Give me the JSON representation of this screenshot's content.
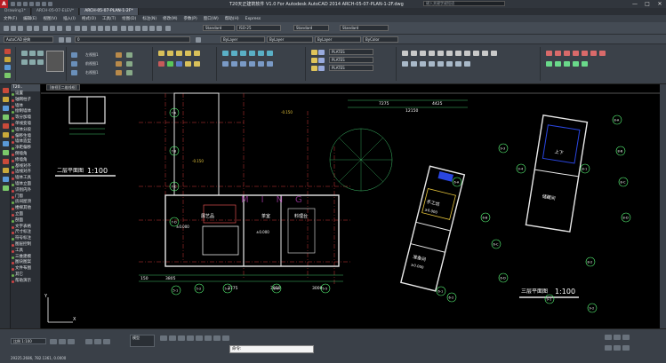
{
  "app": {
    "title": "T20天正建筑软件 V1.0 For Autodesk AutoCAD 2014    ARCH-05-07-PLAN-1-2F.dwg",
    "logo": "A",
    "search_placeholder": "键入关键字或短语",
    "window_controls": [
      "—",
      "□",
      "✕"
    ]
  },
  "tabs": [
    "Drawing1*",
    "ARCH-05-07-ELEV*",
    "ARCH-05-07-PLAN-1-2F*"
  ],
  "menu": [
    "文件(F)",
    "编辑(E)",
    "视图(V)",
    "插入(I)",
    "格式(O)",
    "工具(T)",
    "绘图(D)",
    "标注(N)",
    "修改(M)",
    "参数(P)",
    "窗口(W)",
    "帮助(H)",
    "Express"
  ],
  "toolbar": {
    "workspace": "AutoCAD 经典",
    "textstyle": "Standard",
    "dimstyle": "ISO-25",
    "tablestyle": "Standard",
    "mleaderstyle": "Standard",
    "color": "ByLayer",
    "linetype": "ByLayer",
    "lineweight": "ByLayer",
    "plotstyle": "ByColor"
  },
  "ribbon": {
    "layers": [
      "0",
      "PLATES",
      "PLATES",
      "PLATES"
    ],
    "labels": [
      "左视图1",
      "前视图1",
      "右视图1"
    ]
  },
  "tangent_panel": {
    "header": "T20..",
    "items": [
      "设置",
      "轴网柱子",
      "墙体",
      "绘制墙体",
      "等分加墙",
      "单线变墙",
      "墙体分段",
      "偏移生墙",
      "墙体造型",
      "净距偏移",
      "倒墙角",
      "修墙角",
      "基线对齐",
      "边线对齐",
      "墙体工具",
      "墙体立面",
      "识别内外",
      "门窗",
      "房间屋顶",
      "楼梯其他",
      "立面",
      "剖面",
      "文字表格",
      "尺寸标注",
      "符号标注",
      "图层控制",
      "工具",
      "三维建模",
      "图块图案",
      "文件布图",
      "其它",
      "帮助演示"
    ]
  },
  "viewport_tabs": [
    "[俯视][二维线框]"
  ],
  "drawing": {
    "plan_title_left": "二层平面图",
    "plan_scale_left": "1:100",
    "plan_title_right": "三层平面图",
    "plan_scale_right": "1:100",
    "room_labels": [
      "展艺品",
      "茶室",
      "料理台",
      "手工坊",
      "准备间",
      "储藏间",
      "上下"
    ],
    "elevations": [
      "±0.000",
      "±0.000",
      "±0.000",
      "±0.000",
      "-0.150",
      "±0.000",
      "-0.150"
    ],
    "dims_top": [
      "7275",
      "4425",
      "12150",
      "4325",
      "4875"
    ],
    "dims_bottom": [
      "150",
      "3805",
      "3775",
      "3000",
      "3000",
      "1450",
      "900",
      "1700",
      "1700",
      "1000",
      "2700",
      "1000",
      "450"
    ],
    "dims_small": [
      "2000",
      "3600",
      "3700",
      "200",
      "2600",
      "2000",
      "3400",
      "1800",
      "2000",
      "1200",
      "400",
      "1900",
      "3400",
      "2400",
      "3400",
      "6000",
      "3000",
      "2000",
      "5700",
      "1300",
      "1150",
      "1800",
      "2050",
      "2550",
      "2400",
      "900"
    ],
    "axis_bubbles": [
      "7-A",
      "7-B",
      "7-C",
      "7-D",
      "5-5",
      "5-4",
      "5-3",
      "5-2",
      "5-1",
      "6-1",
      "6-2",
      "6-A",
      "6-B",
      "6-C",
      "6-D",
      "8-A",
      "8-B",
      "8-C",
      "8-D",
      "8-1",
      "8-2",
      "9-1",
      "9-2",
      "9-3",
      "9-4"
    ],
    "watermark": "MING"
  },
  "status": {
    "scale": "比例 1:100",
    "coords": "29225.2686, 782.1361, 0.0000",
    "command_prompt": "命令:",
    "model": "模型",
    "icons": [
      "snap",
      "grid",
      "ortho",
      "polar",
      "osnap",
      "otrack",
      "ducs",
      "dyn",
      "lwt",
      "tpy",
      "qp",
      "sc",
      "am"
    ]
  },
  "colors": {
    "bg": "#000000",
    "wall": "#e8e8e8",
    "axis": "#d23a3a",
    "dim": "#3fc16b",
    "text": "#ffffff",
    "accent": "#e8c63b",
    "bubble": "#5aff7a"
  }
}
